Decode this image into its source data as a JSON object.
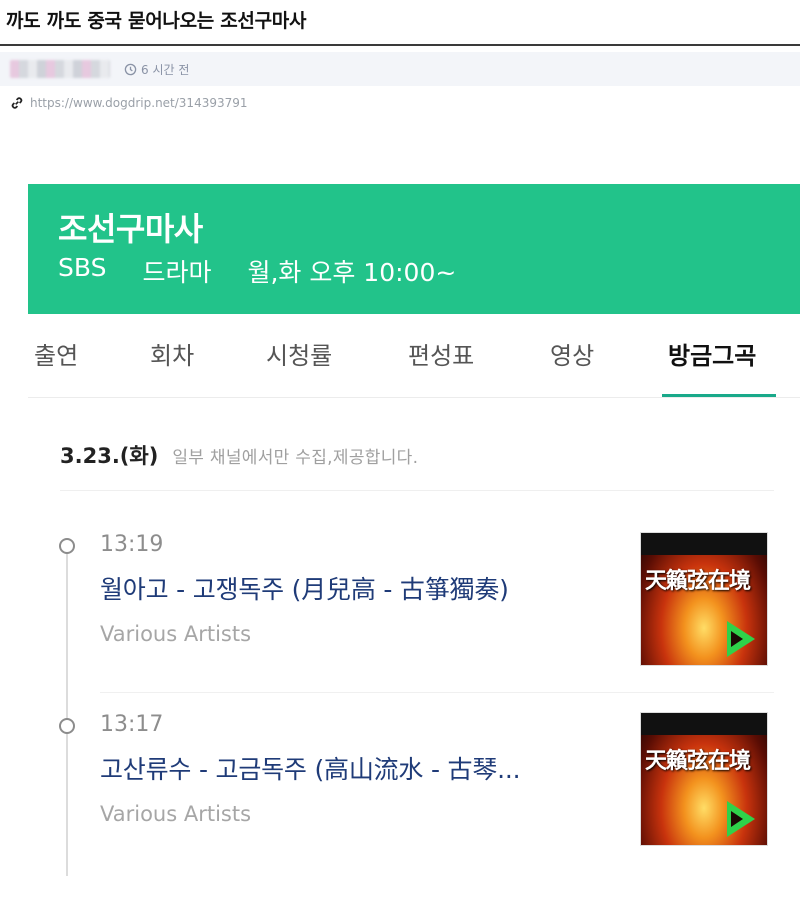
{
  "post": {
    "title": "까도 까도 중국 묻어나오는 조선구마사",
    "time_ago": "6 시간 전",
    "source_url": "https://www.dogdrip.net/314393791"
  },
  "show": {
    "title": "조선구마사",
    "channel": "SBS",
    "genre": "드라마",
    "schedule": "월,화 오후 10:00~",
    "banner_color": "#22c38a"
  },
  "tabs": [
    {
      "label": "출연"
    },
    {
      "label": "회차"
    },
    {
      "label": "시청률"
    },
    {
      "label": "편성표"
    },
    {
      "label": "영상"
    },
    {
      "label": "방금그곡",
      "active": true
    }
  ],
  "playlist": {
    "date": "3.23.(화)",
    "note": "일부 채널에서만 수집,제공합니다.",
    "tracks": [
      {
        "time": "13:19",
        "title": "월아고 - 고쟁독주 (月兒高 - 古箏獨奏)",
        "artist": "Various Artists",
        "cover": {
          "title": "天籟弦在境",
          "play_icon": "play-icon"
        }
      },
      {
        "time": "13:17",
        "title": "고산류수 - 고금독주 (高山流水 - 古琴...",
        "artist": "Various Artists",
        "cover": {
          "title": "天籟弦在境",
          "play_icon": "play-icon"
        }
      }
    ]
  },
  "colors": {
    "accent": "#19a98a",
    "track_title": "#1f3b78"
  }
}
